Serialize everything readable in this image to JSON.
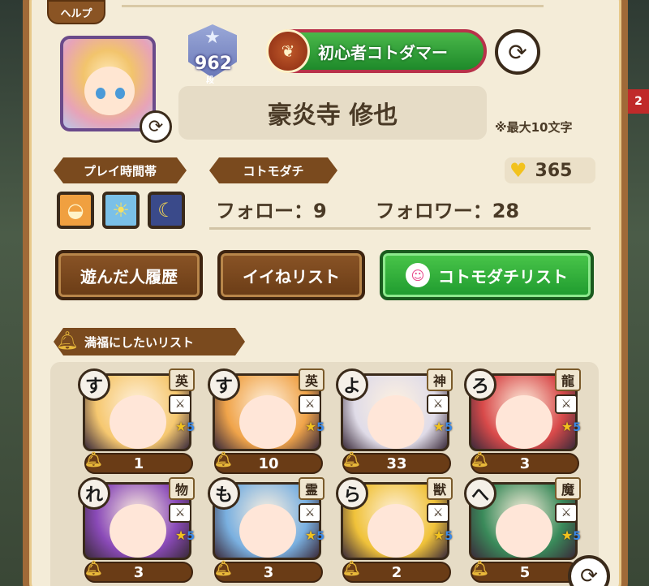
{
  "help": {
    "label": "ヘルプ"
  },
  "profile": {
    "rank": "962",
    "rank_unit": "段",
    "title": "初心者コトダマー",
    "name": "豪炎寺 修也",
    "name_note": "※最大10文字"
  },
  "play_time": {
    "tag": "プレイ時間帯",
    "icons": [
      "sunrise-icon",
      "sun-icon",
      "moon-icon"
    ]
  },
  "kotomodachi": {
    "tag": "コトモダチ",
    "follow": "フォロー：9",
    "follower": "フォロワー：28"
  },
  "likes": {
    "count": "365"
  },
  "buttons": {
    "played_history": "遊んだ人履歴",
    "like_list": "イイねリスト",
    "friend_list": "コトモダチリスト"
  },
  "wishlist": {
    "tag": "満福にしたいリスト",
    "cards": [
      {
        "initial": "す",
        "race": "英",
        "stars": "5",
        "count": "1",
        "color": "#f6c870"
      },
      {
        "initial": "す",
        "race": "英",
        "stars": "5",
        "count": "10",
        "color": "#f0a44a"
      },
      {
        "initial": "よ",
        "race": "神",
        "stars": "5",
        "count": "33",
        "color": "#e0dce8"
      },
      {
        "initial": "ろ",
        "race": "龍",
        "stars": "5",
        "count": "3",
        "color": "#d84a4a"
      },
      {
        "initial": "れ",
        "race": "物",
        "stars": "5",
        "count": "3",
        "color": "#8a4ab8"
      },
      {
        "initial": "も",
        "race": "霊",
        "stars": "5",
        "count": "3",
        "color": "#7ab0e0"
      },
      {
        "initial": "ら",
        "race": "獣",
        "stars": "5",
        "count": "2",
        "color": "#f0c23a"
      },
      {
        "initial": "へ",
        "race": "魔",
        "stars": "5",
        "count": "5",
        "color": "#3a8a5a"
      }
    ]
  },
  "side": {
    "badge": "2"
  }
}
